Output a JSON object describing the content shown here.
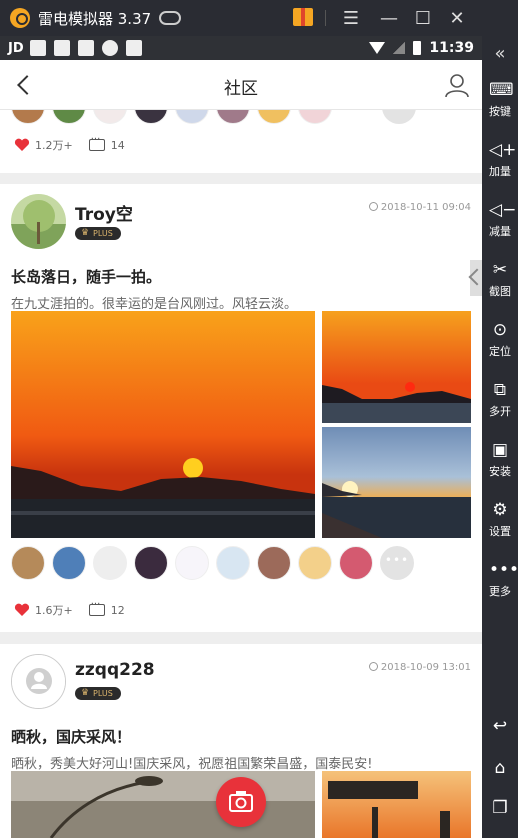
{
  "emulator": {
    "title": "雷电模拟器 3.37",
    "sidebar": [
      "按键",
      "加量",
      "减量",
      "截图",
      "定位",
      "多开",
      "安装",
      "设置",
      "更多"
    ]
  },
  "status_bar": {
    "app": "JD",
    "time": "11:39"
  },
  "header": {
    "title": "社区"
  },
  "posts": [
    {
      "likes": "1.2万+",
      "comments": "14"
    },
    {
      "username": "Troy空",
      "badge": "PLUS",
      "date": "2018-10-11 09:04",
      "title": "长岛落日，随手一拍。",
      "text": "在九丈涯拍的。很幸运的是台风刚过。风轻云淡。",
      "likes": "1.6万+",
      "comments": "12"
    },
    {
      "username": "zzqq228",
      "badge": "PLUS",
      "date": "2018-10-09 13:01",
      "title": "晒秋，国庆采风！",
      "text": "晒秋，秀美大好河山!国庆采风，祝愿祖国繁荣昌盛，国泰民安!"
    }
  ],
  "colors": {
    "accent": "#e8323a",
    "emulator_bg": "#2a2c33"
  }
}
